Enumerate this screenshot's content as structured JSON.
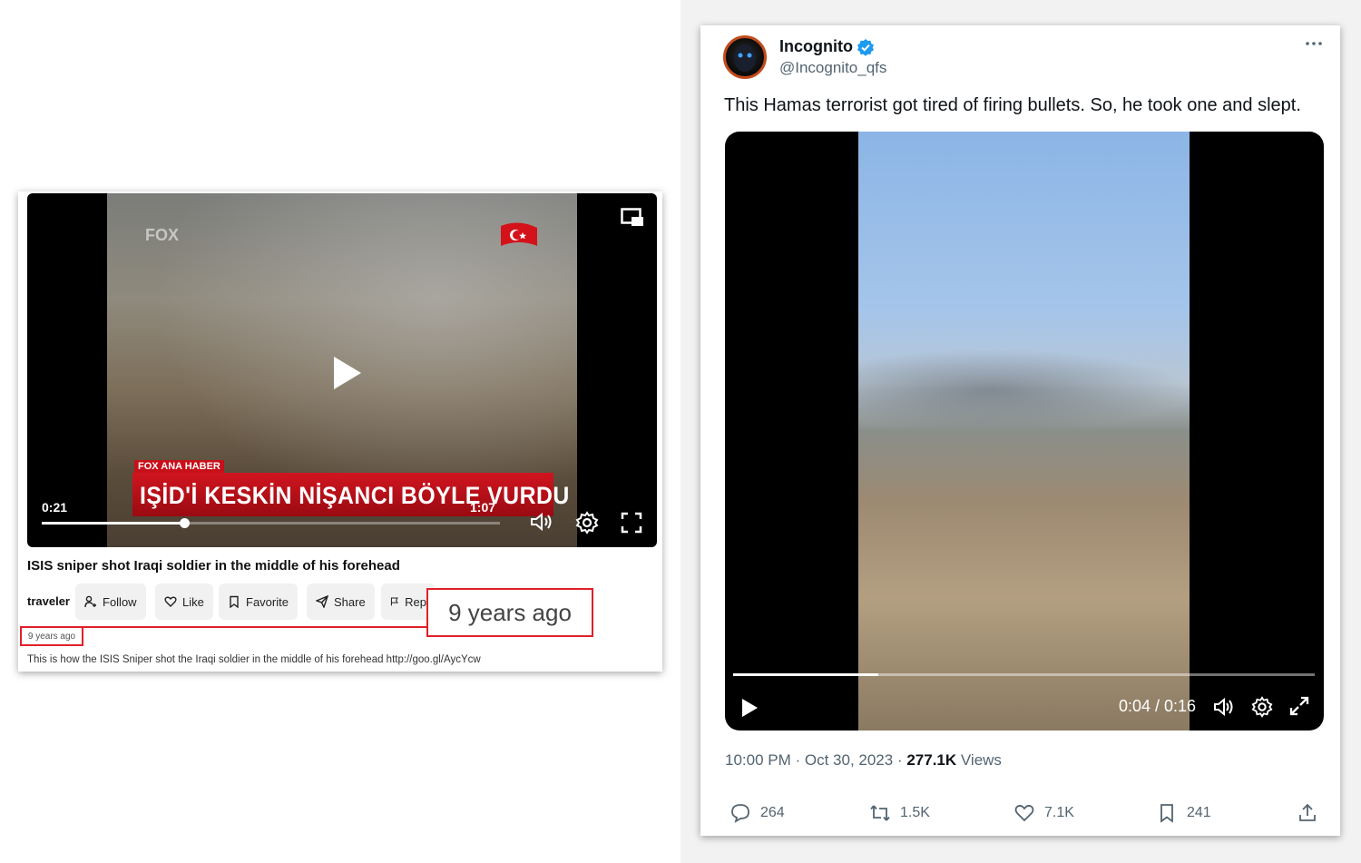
{
  "left_panel": {
    "video": {
      "overlay_logo": "FOX",
      "caption_tag": "FOX ANA HABER",
      "caption_text": "IŞİD'İ KESKİN NİŞANCI BÖYLE VURDU",
      "current_time": "0:21",
      "duration": "1:07",
      "progress_fraction": 0.31
    },
    "title": "ISIS sniper shot Iraqi soldier in the middle of his forehead",
    "uploader": "traveler",
    "actions": [
      {
        "label": "Follow",
        "icon": "add-user-icon"
      },
      {
        "label": "Like",
        "icon": "heart-icon"
      },
      {
        "label": "Favorite",
        "icon": "bookmark-icon"
      },
      {
        "label": "Share",
        "icon": "send-icon"
      },
      {
        "label": "Rep",
        "icon": "flag-icon"
      }
    ],
    "zoom_callout": "9 years ago",
    "upload_date": "9 years ago",
    "description": "This is how the ISIS Sniper shot the Iraqi soldier in the middle of his forehead http://goo.gl/AycYcw",
    "highlight_color": "#e0202a"
  },
  "tweet": {
    "display_name": "Incognito",
    "handle": "@Incognito_qfs",
    "verified": true,
    "text": "This Hamas terrorist got tired of firing bullets. So, he took one and slept.",
    "video": {
      "time": "0:04 / 0:16",
      "progress_fraction": 0.25
    },
    "meta_prefix": "10:00 PM · Oct 30, 2023 · ",
    "views_count": "277.1K",
    "views_label": " Views",
    "stats": {
      "replies": "264",
      "retweets": "1.5K",
      "likes": "7.1K",
      "bookmarks": "241"
    },
    "accent_color": "#1d9bf0"
  }
}
